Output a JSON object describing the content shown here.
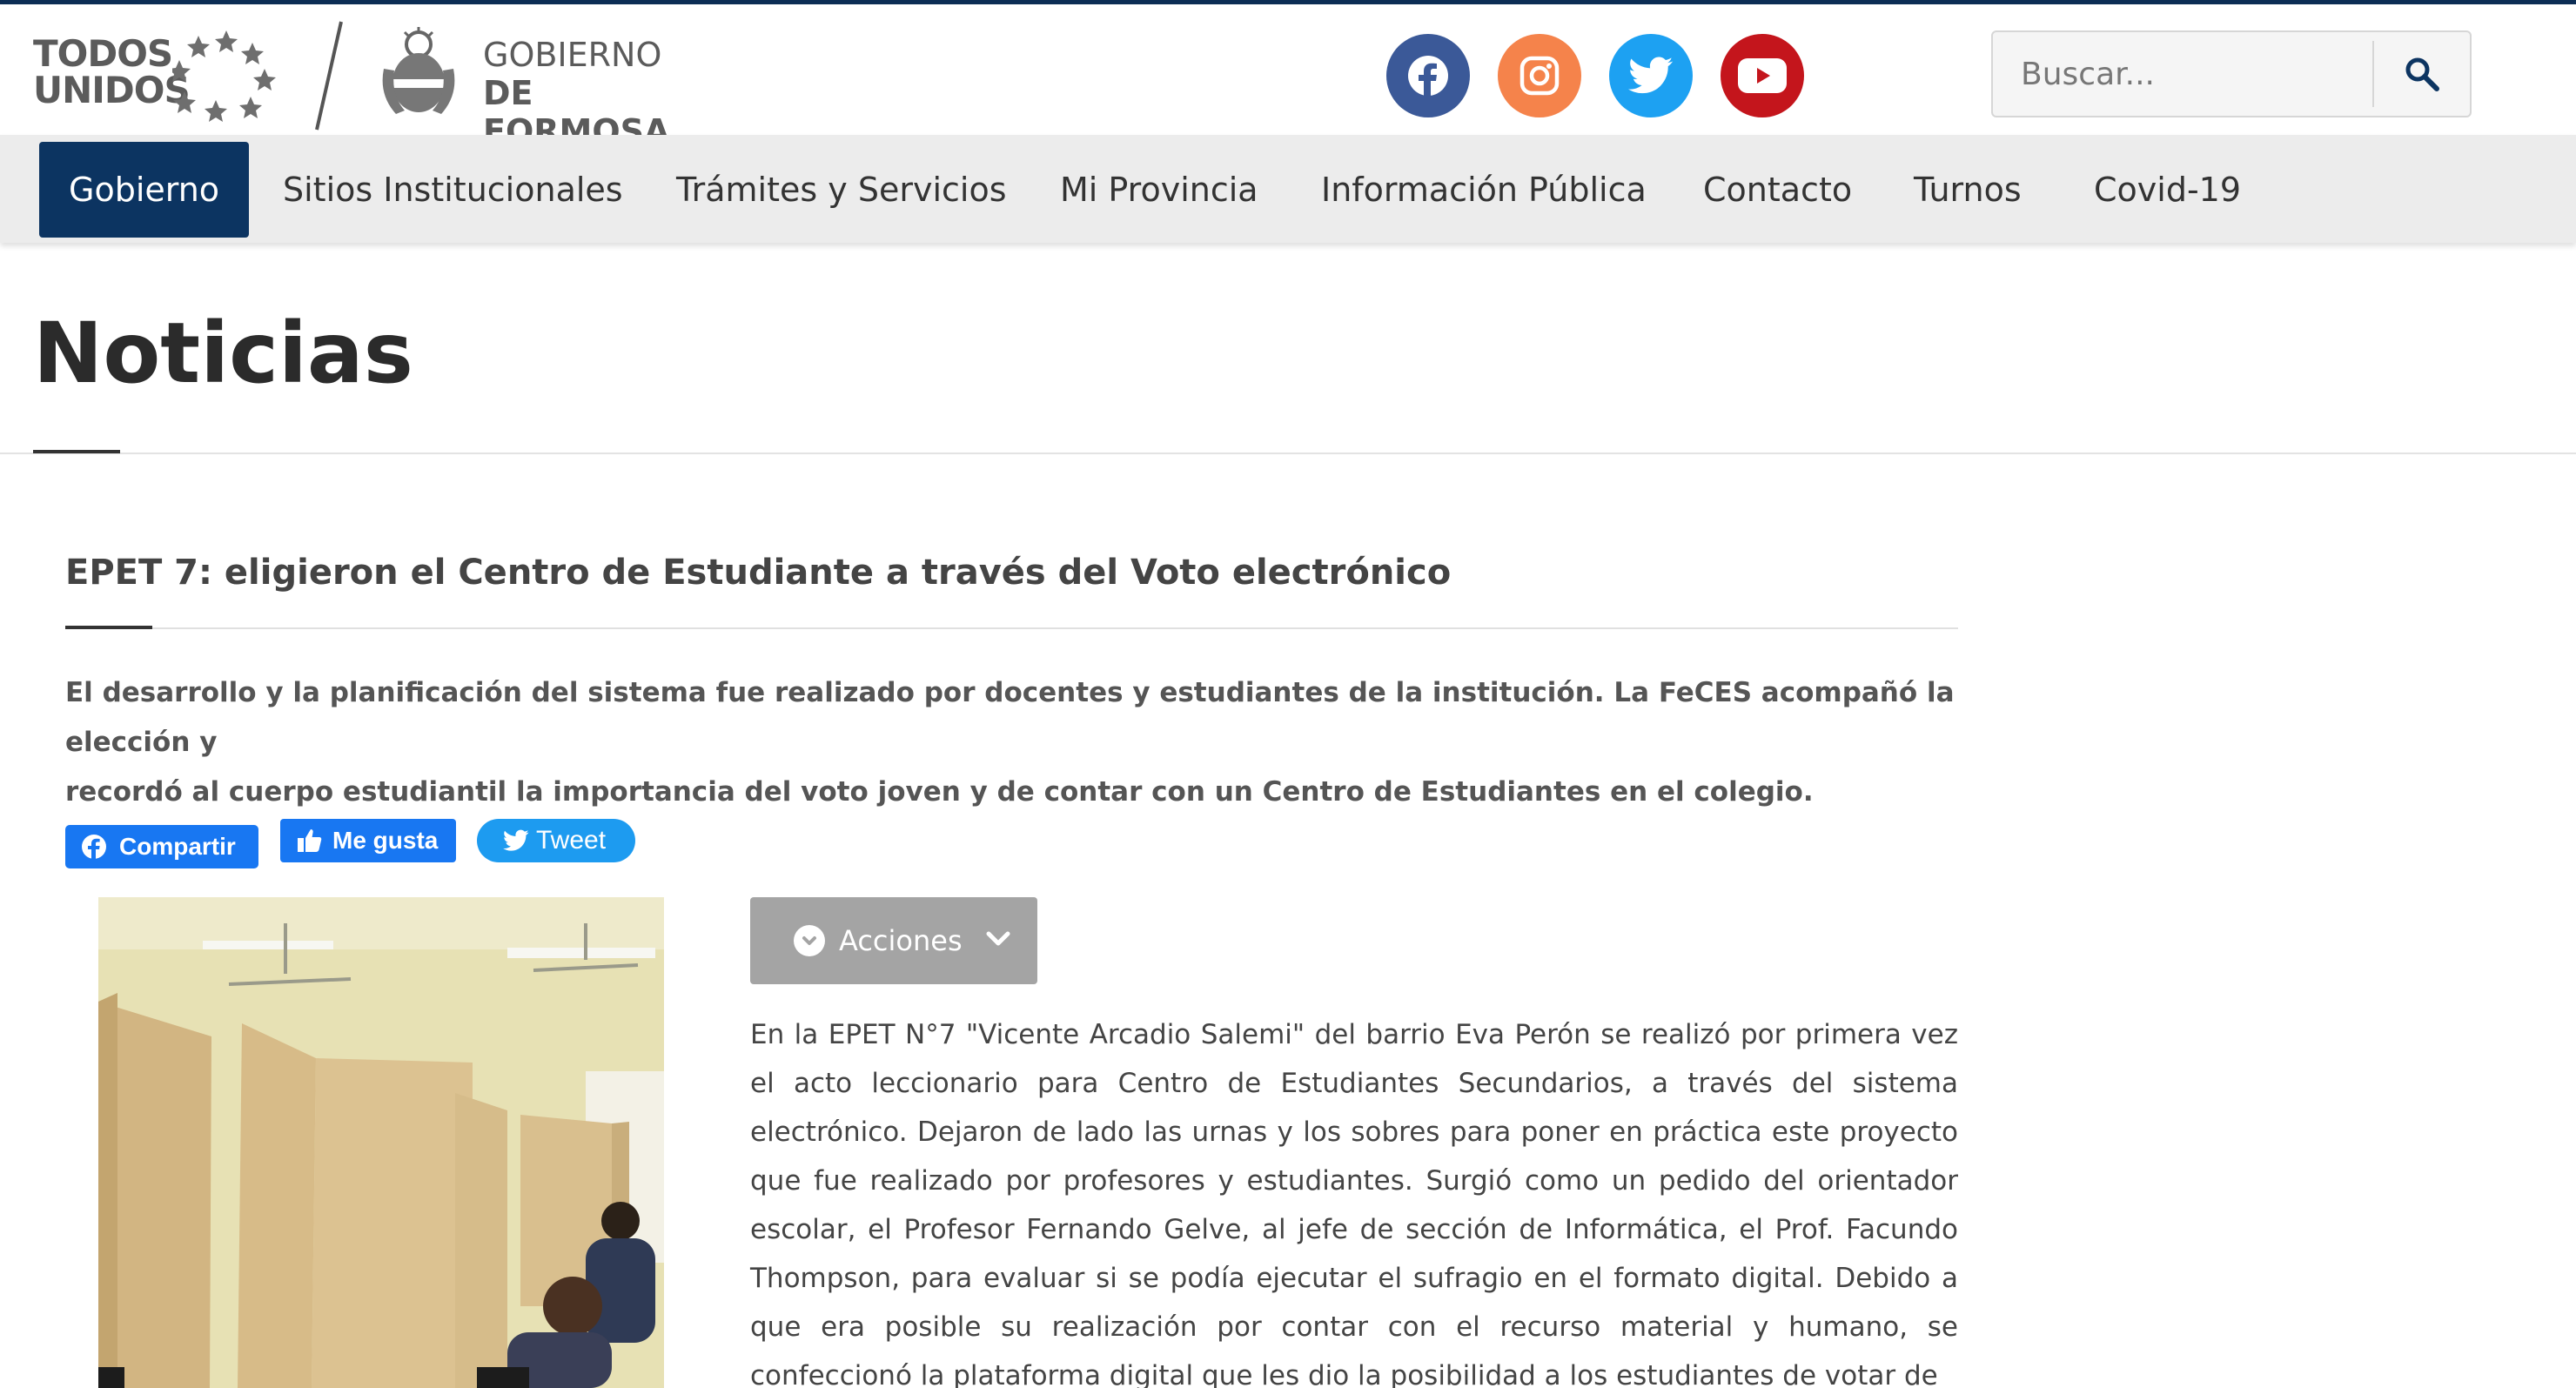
{
  "colors": {
    "brand_navy": "#0c3461",
    "facebook": "#3b5998",
    "instagram": "#f5834b",
    "twitter": "#1da1f2",
    "youtube": "#c4151c",
    "nav_bg": "#ececec",
    "acciones_bg": "#a4a4a4"
  },
  "header": {
    "logo_todos": {
      "line1": "TODOS",
      "line2": "UNIDOS"
    },
    "logo_gobierno": {
      "line1": "GOBIERNO",
      "line2": "DE FORMOSA"
    },
    "social": [
      "facebook-icon",
      "instagram-icon",
      "twitter-icon",
      "youtube-icon"
    ],
    "search": {
      "placeholder": "Buscar...",
      "value": "",
      "icon": "search-icon"
    }
  },
  "nav": {
    "items": [
      {
        "label": "Gobierno",
        "active": true
      },
      {
        "label": "Sitios Institucionales"
      },
      {
        "label": "Trámites y Servicios"
      },
      {
        "label": "Mi Provincia"
      },
      {
        "label": "Información Pública"
      },
      {
        "label": "Contacto"
      },
      {
        "label": "Turnos"
      },
      {
        "label": "Covid-19"
      }
    ]
  },
  "page": {
    "title": "Noticias"
  },
  "article": {
    "title": "EPET 7: eligieron el Centro de Estudiante a través del Voto electrónico",
    "lead_line1": "El desarrollo y la planificación del sistema fue realizado por docentes y estudiantes de la institución. La FeCES acompañó la elección y",
    "lead_line2": "recordó al cuerpo estudiantil la importancia del voto joven y de contar con un Centro de Estudiantes en el colegio.",
    "share": {
      "facebook": "Compartir",
      "like": "Me gusta",
      "tweet": "Tweet"
    },
    "actions_label": "Acciones",
    "body": "En la EPET N°7 \"Vicente Arcadio Salemi\" del barrio Eva Perón se realizó por primera vez el acto leccionario para Centro de Estudiantes Secundarios, a través del sistema electrónico. Dejaron de lado las urnas y los sobres para poner en práctica este proyecto que fue realizado por profesores y estudiantes. Surgió como un pedido del orientador escolar, el Profesor Fernando Gelve, al jefe de sección de Informática, el Prof. Facundo Thompson, para evaluar si se podía ejecutar el sufragio en el formato digital. Debido a que era posible su realización por contar con el recurso material y humano, se confeccionó la plataforma digital que les dio la posibilidad a los estudiantes de votar de"
  }
}
